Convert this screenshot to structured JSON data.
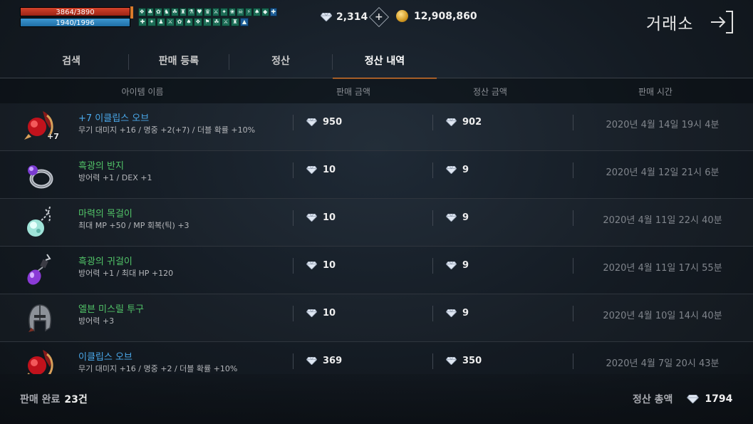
{
  "hud": {
    "hp": "3864/3890",
    "mp": "1940/1996",
    "buffs_row1": [
      "❖",
      "♣",
      "✿",
      "♞",
      "☘",
      "♜",
      "⚗",
      "♥",
      "♛",
      "⚔",
      "✦",
      "❀",
      "☠",
      "⚡",
      "♠",
      "◆",
      "✚"
    ],
    "buffs_row2": [
      "✚",
      "✦",
      "♟",
      "⚔",
      "✿",
      "♠",
      "❖",
      "⚑",
      "☘",
      "⚔",
      "♜",
      "▲"
    ],
    "diamonds": "2,314",
    "plus_symbol": "+",
    "gold": "12,908,860",
    "title": "거래소"
  },
  "tabs": [
    {
      "label": "검색"
    },
    {
      "label": "판매 등록"
    },
    {
      "label": "정산"
    },
    {
      "label": "정산 내역"
    }
  ],
  "table": {
    "headers": {
      "name": "아이템 이름",
      "sale_price": "판매 금액",
      "settled": "정산 금액",
      "time": "판매 시간"
    },
    "rows": [
      {
        "name": "+7 이클립스 오브",
        "name_color": "#4aa8ea",
        "enhance": "+7",
        "icon": "red-orb-icon",
        "stats": "무기 대미지 +16 / 명중 +2(+7) / 더블 확률 +10%",
        "price": "950",
        "settled": "902",
        "time": "2020년 4월 14일 19시 4분"
      },
      {
        "name": "흑광의 반지",
        "name_color": "#52c468",
        "enhance": "",
        "icon": "ring-icon",
        "stats": "방어력 +1 / DEX +1",
        "price": "10",
        "settled": "9",
        "time": "2020년 4월 12일 21시 6분"
      },
      {
        "name": "마력의 목걸이",
        "name_color": "#52c468",
        "enhance": "",
        "icon": "necklace-icon",
        "stats": "최대 MP +50 / MP 회복(틱) +3",
        "price": "10",
        "settled": "9",
        "time": "2020년 4월 11일 22시 40분"
      },
      {
        "name": "흑광의 귀걸이",
        "name_color": "#52c468",
        "enhance": "",
        "icon": "earring-icon",
        "stats": "방어력 +1 / 최대 HP +120",
        "price": "10",
        "settled": "9",
        "time": "2020년 4월 11일 17시 55분"
      },
      {
        "name": "엘븐 미스릴 투구",
        "name_color": "#52c468",
        "enhance": "",
        "icon": "helmet-icon",
        "stats": "방어력 +3",
        "price": "10",
        "settled": "9",
        "time": "2020년 4월 10일 14시 40분"
      },
      {
        "name": "이클립스 오브",
        "name_color": "#4aa8ea",
        "enhance": "",
        "icon": "red-orb-icon",
        "stats": "무기 대미지 +16 / 명중 +2 / 더블 확률 +10%",
        "price": "369",
        "settled": "350",
        "time": "2020년 4월 7일 20시 43분"
      }
    ]
  },
  "footer": {
    "sold_label": "판매 완료",
    "sold_count": "23건",
    "total_label": "정산 총액",
    "total_value": "1794"
  }
}
